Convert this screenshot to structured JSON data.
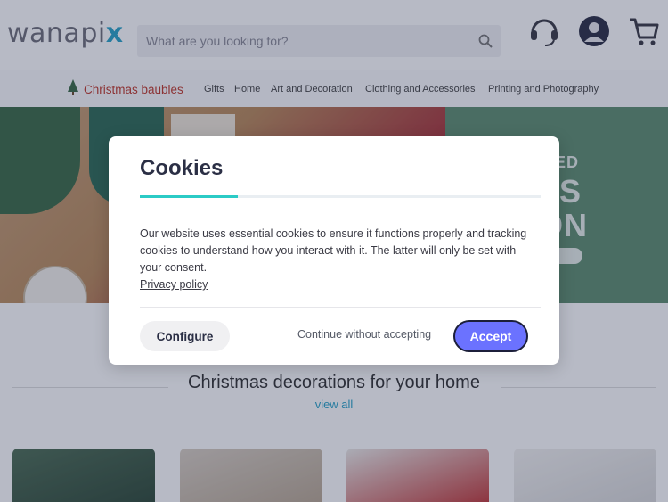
{
  "header": {
    "logo_text": "wanapi",
    "logo_accent": "x",
    "search_placeholder": "What are you looking for?",
    "icons": [
      "support-headset-icon",
      "account-icon",
      "cart-icon"
    ]
  },
  "nav": {
    "special_item": "Christmas baubles",
    "items": [
      "Gifts",
      "Home",
      "Art and Decoration",
      "Clothing and Accessories",
      "Printing and Photography"
    ]
  },
  "hero": {
    "line1": "SED",
    "line2": "MAS",
    "line3": "TION"
  },
  "section": {
    "title": "Christmas decorations for your home",
    "view_all": "view all"
  },
  "modal": {
    "title": "Cookies",
    "body": "Our website uses essential cookies to ensure it functions properly and tracking cookies to understand how you interact with it. The latter will only be set with your consent.",
    "privacy_link": "Privacy policy",
    "configure_label": "Configure",
    "continue_label": "Continue without accepting",
    "accept_label": "Accept"
  },
  "colors": {
    "accent": "#6b72ff",
    "progress": "#2bcbc6",
    "special_nav": "#c0392b",
    "link": "#2aa3c8"
  }
}
